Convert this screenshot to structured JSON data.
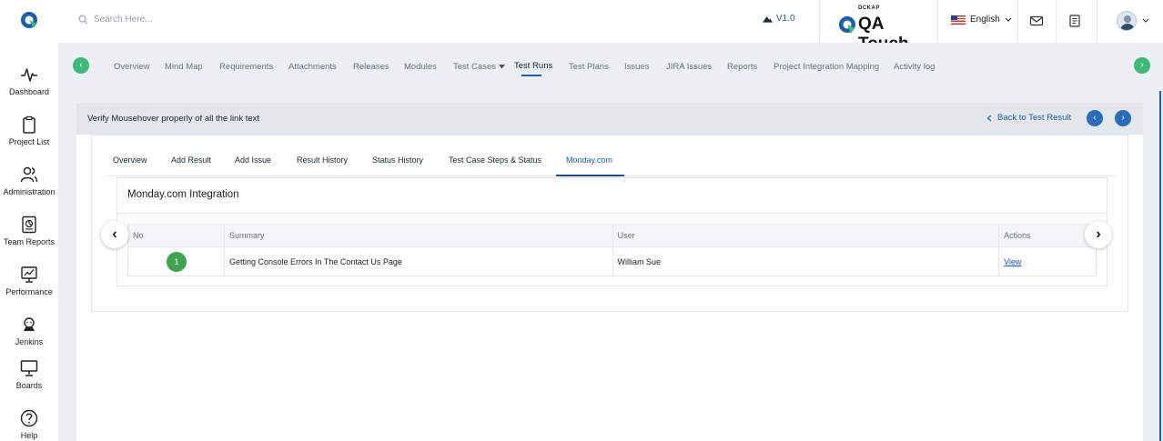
{
  "header": {
    "search_placeholder": "Search Here...",
    "version": "V1.0",
    "brand_small": "DCKAP",
    "brand_name": "QA Touch",
    "language": "English"
  },
  "sidebar": {
    "items": [
      {
        "label": "Dashboard",
        "icon": "pulse-icon"
      },
      {
        "label": "Project List",
        "icon": "clipboard-icon"
      },
      {
        "label": "Administration",
        "icon": "users-icon"
      },
      {
        "label": "Team Reports",
        "icon": "report-icon"
      },
      {
        "label": "Performance",
        "icon": "performance-icon"
      },
      {
        "label": "Jenkins",
        "icon": "jenkins-icon"
      },
      {
        "label": "Boards",
        "icon": "board-icon"
      },
      {
        "label": "Help",
        "icon": "help-icon"
      }
    ]
  },
  "nav": {
    "tabs": [
      "Overview",
      "Mind Map",
      "Requirements",
      "Attachments",
      "Releases",
      "Modules",
      "Test Cases",
      "Test Runs",
      "Test Plans",
      "Issues",
      "JIRA Issues",
      "Reports",
      "Project Integration Mapping",
      "Activity log"
    ],
    "active": "Test Runs"
  },
  "panel": {
    "title": "Verify Mousehover properly of all the link text",
    "back_link": "Back to Test Result"
  },
  "subtabs": {
    "items": [
      "Overview",
      "Add Result",
      "Add Issue",
      "Result History",
      "Status History",
      "Test Case Steps & Status",
      "Monday.com"
    ],
    "active": "Monday.com"
  },
  "integration": {
    "title": "Monday.com Integration",
    "columns": [
      "No",
      "Summary",
      "User",
      "Actions"
    ],
    "rows": [
      {
        "no": "1",
        "summary": "Getting Console Errors In The Contact Us Page",
        "user": "William Sue",
        "action": "View"
      }
    ]
  },
  "colors": {
    "accent_green": "#3fb87a",
    "accent_blue": "#1e5fa6",
    "badge_green": "#3fa34d"
  }
}
